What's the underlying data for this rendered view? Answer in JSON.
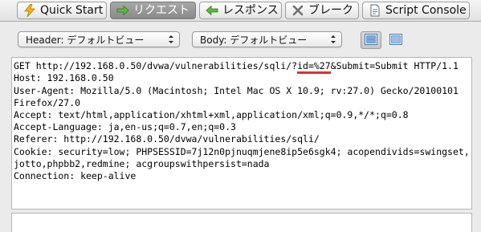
{
  "tabs": [
    {
      "label": "Quick Start",
      "icon": "lightning-icon",
      "active": false
    },
    {
      "label": "リクエスト",
      "icon": "arrow-right-icon",
      "active": true
    },
    {
      "label": "レスポンス",
      "icon": "arrow-left-icon",
      "active": false
    },
    {
      "label": "ブレーク",
      "icon": "cross-icon",
      "active": false
    },
    {
      "label": "Script Console",
      "icon": "document-icon",
      "active": false
    }
  ],
  "toolbar": {
    "header_view": "Header: デフォルトビュー",
    "body_view": "Body: デフォルトビュー"
  },
  "request": {
    "request_line_prefix": "GET http://192.168.0.50/dvwa/vulnerabilities/sqli/?",
    "request_line_param": "id=%27",
    "request_line_suffix": "&Submit=Submit HTTP/1.1",
    "lines": [
      "Host: 192.168.0.50",
      "User-Agent: Mozilla/5.0 (Macintosh; Intel Mac OS X 10.9; rv:27.0) Gecko/20100101",
      "Firefox/27.0",
      "Accept: text/html,application/xhtml+xml,application/xml;q=0.9,*/*;q=0.8",
      "Accept-Language: ja,en-us;q=0.7,en;q=0.3",
      "Referer: http://192.168.0.50/dvwa/vulnerabilities/sqli/",
      "Cookie: security=low; PHPSESSID=7j12n0pjnuqmjene8ip5e6sgk4; acopendivids=swingset,",
      "jotto,phpbb2,redmine; acgroupswithpersist=nada",
      "Connection: keep-alive"
    ]
  },
  "colors": {
    "accent_active_tab": "#8f8f8f",
    "highlight_underline": "#d9342b",
    "view_button_blue": "#5a8fcf"
  }
}
